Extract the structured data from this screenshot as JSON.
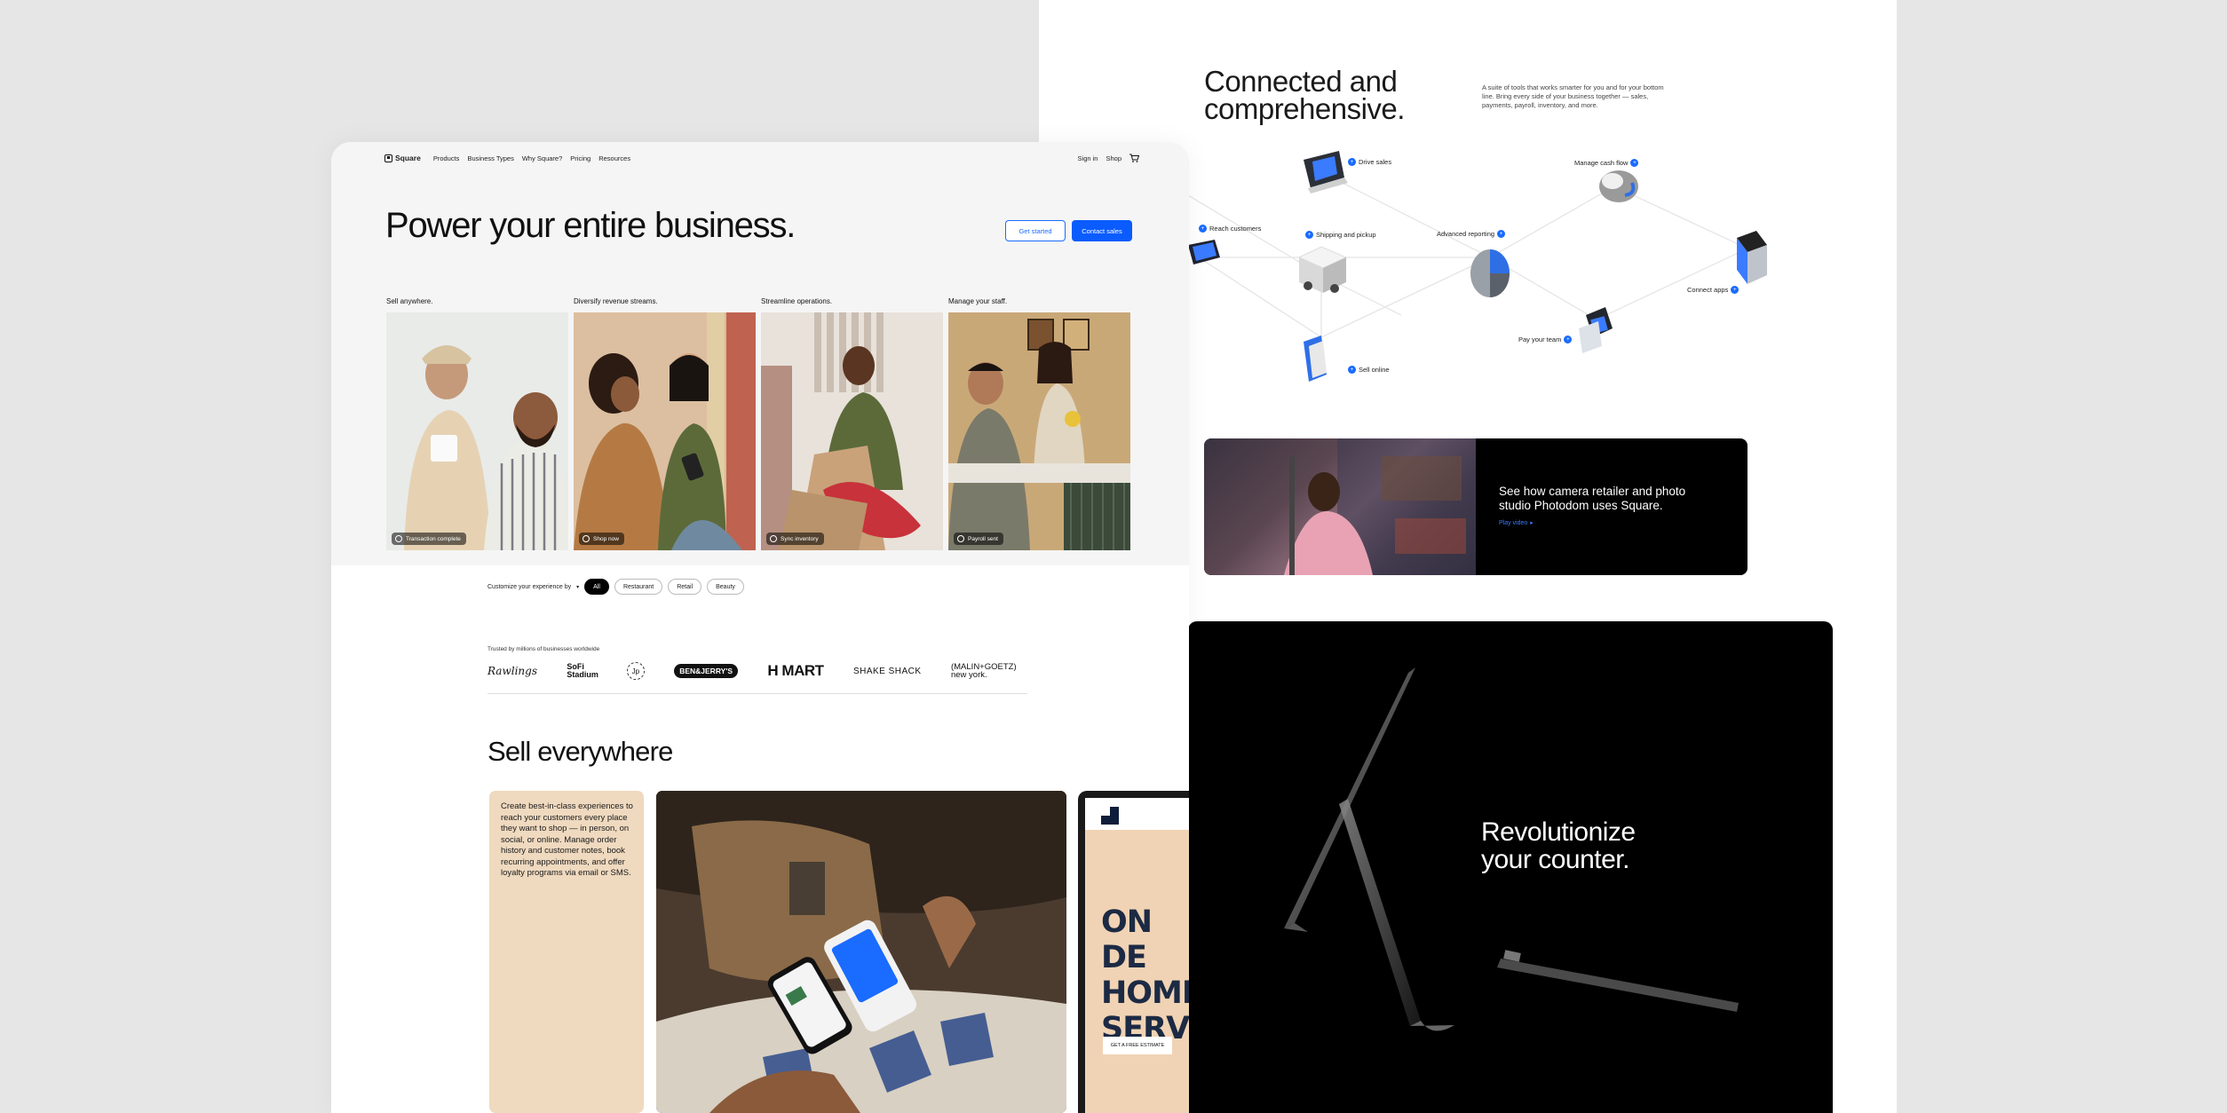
{
  "connected": {
    "title": "Connected and\ncomprehensive.",
    "description": "A suite of tools that works smarter for you and for your bottom line. Bring every side of your business together — sales, payments, payroll, inventory, and more.",
    "diagram_labels": [
      "Drive sales",
      "Manage cash flow",
      "Reach customers",
      "Shipping and pickup",
      "Advanced reporting",
      "Connect apps",
      "Pay your team",
      "Sell online"
    ]
  },
  "video_card": {
    "text": "See how camera retailer and photo studio Photodom uses Square.",
    "link": "Play video"
  },
  "counter_card": {
    "title": "Revolutionize\nyour counter."
  },
  "nav": {
    "logo": "Square",
    "items": [
      "Products",
      "Business Types",
      "Why Square?",
      "Pricing",
      "Resources"
    ],
    "sign_in": "Sign in",
    "shop": "Shop"
  },
  "hero": {
    "title": "Power your entire business.",
    "get_started": "Get started",
    "contact_sales": "Contact sales",
    "columns": [
      {
        "caption": "Sell anywhere.",
        "badge": "Transaction complete"
      },
      {
        "caption": "Diversify revenue streams.",
        "badge": "Shop now"
      },
      {
        "caption": "Streamline operations.",
        "badge": "Sync inventory"
      },
      {
        "caption": "Manage your staff.",
        "badge": "Payroll sent"
      }
    ]
  },
  "customize": {
    "label": "Customize your experience by",
    "pills": [
      "All",
      "Restaurant",
      "Retail",
      "Beauty"
    ]
  },
  "trusted": {
    "label": "Trusted by millions of businesses worldwide",
    "brands": [
      "Rawlings",
      "SoFi Stadium",
      "Jp",
      "BEN&JERRY'S",
      "H MART",
      "SHAKE SHACK",
      "(MALIN+GOETZ) new york."
    ]
  },
  "sell": {
    "title": "Sell everywhere",
    "body": "Create best-in-class experiences to reach your customers every place they want to shop — in person, on social, or online. Manage order history and customer notes, book recurring appointments, and offer loyalty programs via email or SMS.",
    "tablet_big": "ON DE\nHOME\nSERV",
    "tablet_btn": "GET A FREE ESTIMATE"
  }
}
